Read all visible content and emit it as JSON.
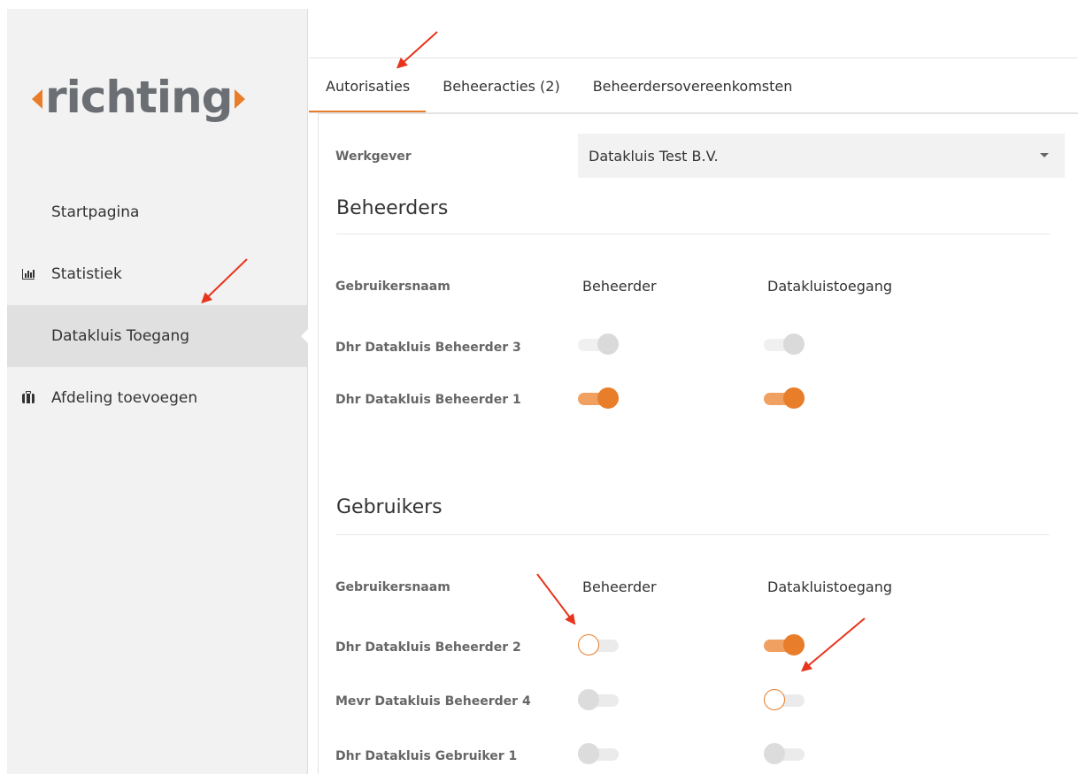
{
  "logo": {
    "word": "richting"
  },
  "sidebar": {
    "items": [
      {
        "label": "Startpagina",
        "icon": "none"
      },
      {
        "label": "Statistiek",
        "icon": "bar-chart-icon"
      },
      {
        "label": "Datakluis Toegang",
        "icon": "none",
        "active": true
      },
      {
        "label": "Afdeling toevoegen",
        "icon": "briefcase-icon"
      }
    ]
  },
  "tabs": [
    {
      "label": "Autorisaties",
      "active": true
    },
    {
      "label": "Beheeracties (2)"
    },
    {
      "label": "Beheerdersovereenkomsten"
    }
  ],
  "employer": {
    "label": "Werkgever",
    "value": "Datakluis Test B.V."
  },
  "beheerders": {
    "title": "Beheerders",
    "columns": [
      "Gebruikersnaam",
      "Beheerder",
      "Datakluistoegang"
    ],
    "rows": [
      {
        "name": "Dhr Datakluis Beheerder 3",
        "beheerder": "on-disabled",
        "datakluis": "on-disabled"
      },
      {
        "name": "Dhr Datakluis Beheerder 1",
        "beheerder": "on",
        "datakluis": "on"
      }
    ]
  },
  "gebruikers": {
    "title": "Gebruikers",
    "columns": [
      "Gebruikersnaam",
      "Beheerder",
      "Datakluistoegang"
    ],
    "rows": [
      {
        "name": "Dhr Datakluis Beheerder 2",
        "beheerder": "off-focus",
        "datakluis": "on"
      },
      {
        "name": "Mevr Datakluis Beheerder 4",
        "beheerder": "off",
        "datakluis": "off-focus"
      },
      {
        "name": "Dhr Datakluis Gebruiker 1",
        "beheerder": "off",
        "datakluis": "off"
      }
    ]
  },
  "colors": {
    "accent": "#e87d2a",
    "annotation": "#e8341c",
    "logo_grey": "#6b6f73"
  }
}
